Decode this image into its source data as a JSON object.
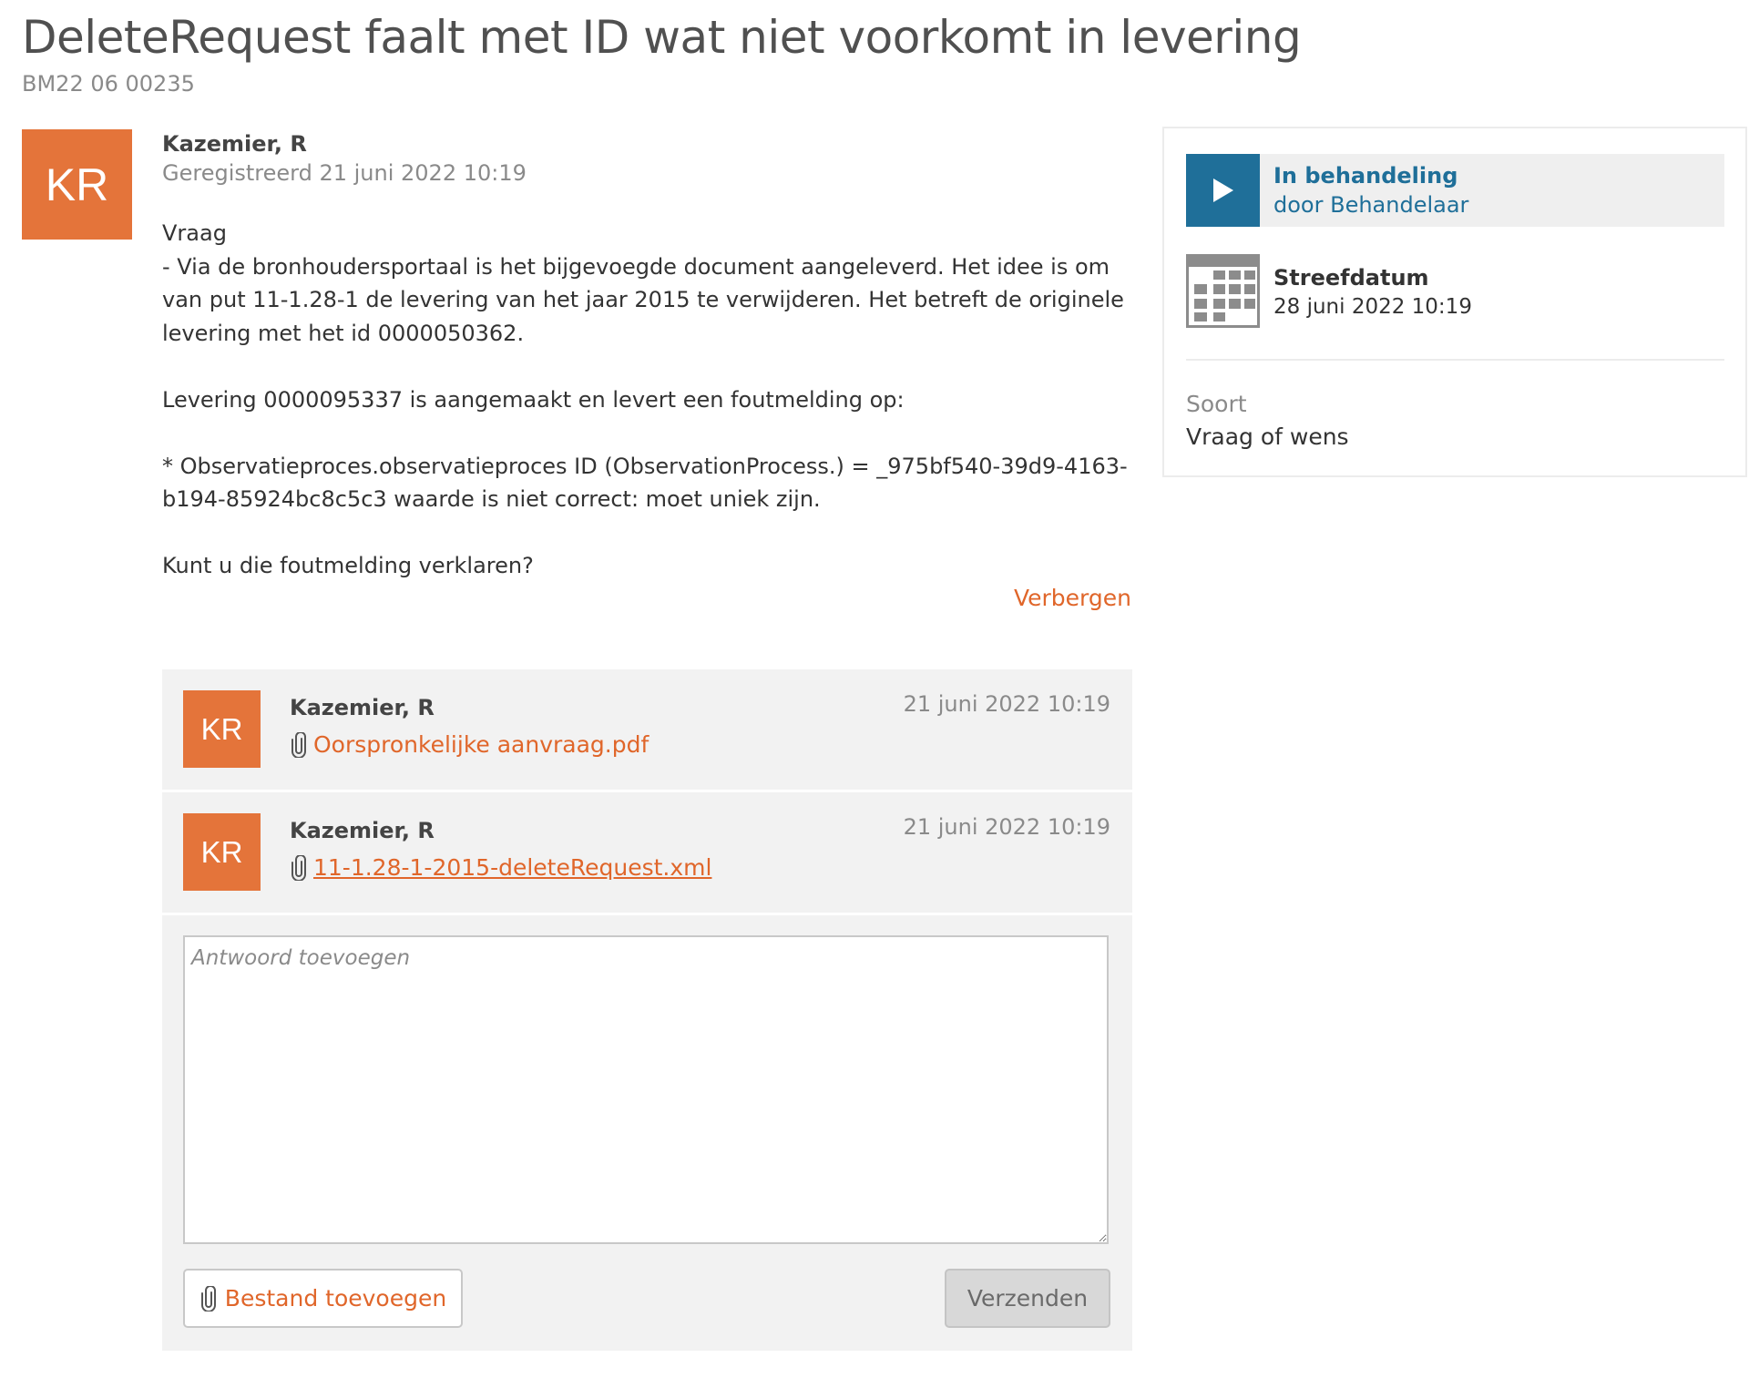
{
  "page": {
    "title": "DeleteRequest faalt met ID wat niet voorkomt in levering",
    "reference": "BM22 06 00235"
  },
  "question": {
    "avatar_initials": "KR",
    "author": "Kazemier, R",
    "registered": "Geregistreerd 21 juni 2022 10:19",
    "body": "Vraag\n- Via de bronhoudersportaal is het bijgevoegde document aangeleverd. Het idee is om van put 11-1.28-1 de levering van het jaar 2015 te verwijderen. Het betreft de originele levering met het id 0000050362.\n\nLevering 0000095337 is aangemaakt en levert een foutmelding op:\n\n* Observatieproces.observatieproces ID (ObservationProcess.) = _975bf540-39d9-4163-b194-85924bc8c5c3 waarde is niet correct: moet uniek zijn.\n\nKunt u die foutmelding verklaren?",
    "hide_label": "Verbergen"
  },
  "replies": [
    {
      "avatar_initials": "KR",
      "author": "Kazemier, R",
      "date": "21 juni 2022 10:19",
      "attachment": "Oorspronkelijke aanvraag.pdf",
      "attachment_icon": "paperclip-icon"
    },
    {
      "avatar_initials": "KR",
      "author": "Kazemier, R",
      "date": "21 juni 2022 10:19",
      "attachment": "11-1.28-1-2015-deleteRequest.xml",
      "attachment_icon": "paperclip-icon"
    }
  ],
  "reply_form": {
    "placeholder": "Antwoord toevoegen",
    "value": "",
    "add_file_label": "Bestand toevoegen",
    "send_label": "Verzenden"
  },
  "sidebar": {
    "status": {
      "label": "In behandeling",
      "by": "door Behandelaar",
      "icon": "play-icon"
    },
    "deadline": {
      "label": "Streefdatum",
      "value": "28 juni 2022 10:19",
      "icon": "calendar-icon"
    },
    "type": {
      "label": "Soort",
      "value": "Vraag of wens"
    }
  },
  "colors": {
    "accent_orange": "#e4743a",
    "link_orange": "#e0662a",
    "status_blue": "#1f6f99",
    "panel_gray": "#f2f2f2",
    "muted_text": "#8a8a8a"
  }
}
